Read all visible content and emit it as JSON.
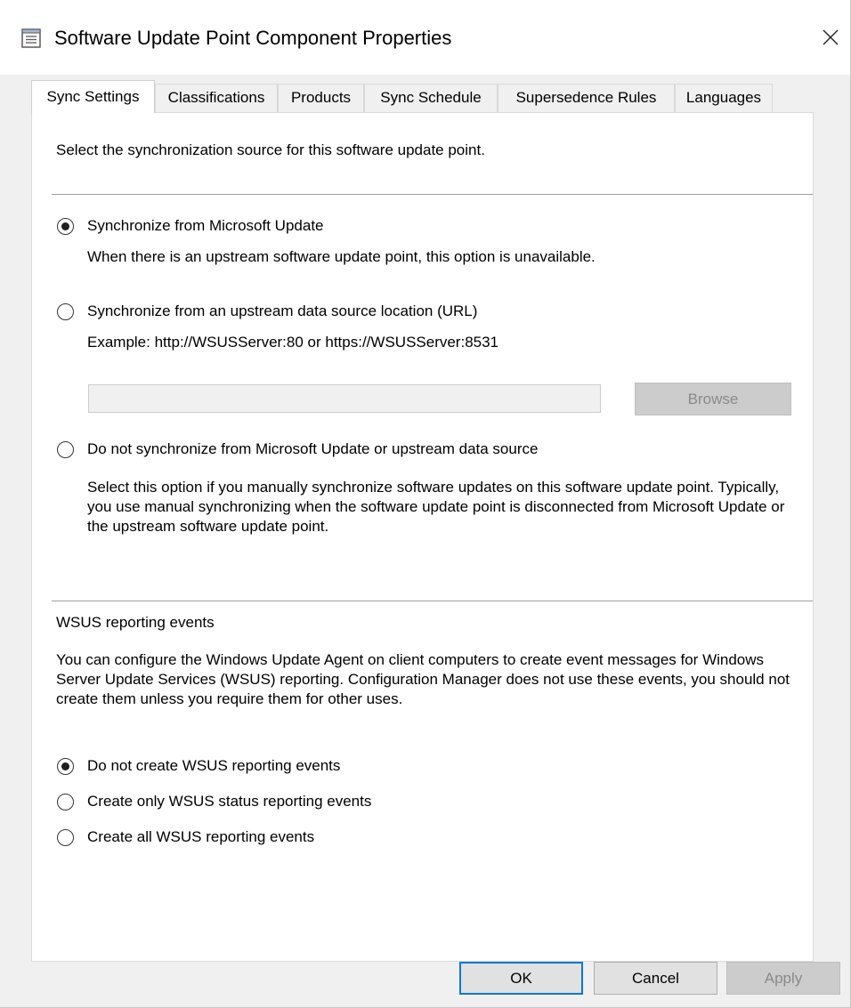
{
  "window": {
    "title": "Software Update Point Component Properties",
    "close_icon": "close-icon",
    "app_icon": "properties-sheet-icon"
  },
  "tabs": [
    {
      "label": "Sync Settings",
      "active": true
    },
    {
      "label": "Classifications",
      "active": false
    },
    {
      "label": "Products",
      "active": false
    },
    {
      "label": "Sync Schedule",
      "active": false
    },
    {
      "label": "Supersedence Rules",
      "active": false
    },
    {
      "label": "Languages",
      "active": false
    }
  ],
  "sync": {
    "intro": "Select the synchronization source for this software update point.",
    "option_microsoft": {
      "label": "Synchronize from Microsoft Update",
      "note": "When there is an upstream software update point, this option is unavailable.",
      "checked": true
    },
    "option_upstream": {
      "label": "Synchronize from an upstream data source location (URL)",
      "example": "Example: http://WSUSServer:80 or https://WSUSServer:8531",
      "url_value": "",
      "browse_label": "Browse",
      "checked": false
    },
    "option_none": {
      "label": "Do not synchronize from Microsoft Update or upstream data source",
      "description": "Select this option if you manually synchronize software updates on this software update point. Typically, you use manual synchronizing when the software update point is disconnected from Microsoft Update or the upstream software update point.",
      "checked": false
    }
  },
  "reporting": {
    "heading": "WSUS reporting events",
    "description": "You can configure the Windows Update Agent on client computers to create event messages for Windows Server Update Services (WSUS) reporting. Configuration Manager does not use these events, you should not create them unless you require them for other uses.",
    "options": [
      {
        "label": "Do not create WSUS reporting events",
        "checked": true
      },
      {
        "label": "Create only WSUS status reporting events",
        "checked": false
      },
      {
        "label": "Create all WSUS reporting events",
        "checked": false
      }
    ]
  },
  "footer": {
    "ok_label": "OK",
    "cancel_label": "Cancel",
    "apply_label": "Apply"
  }
}
